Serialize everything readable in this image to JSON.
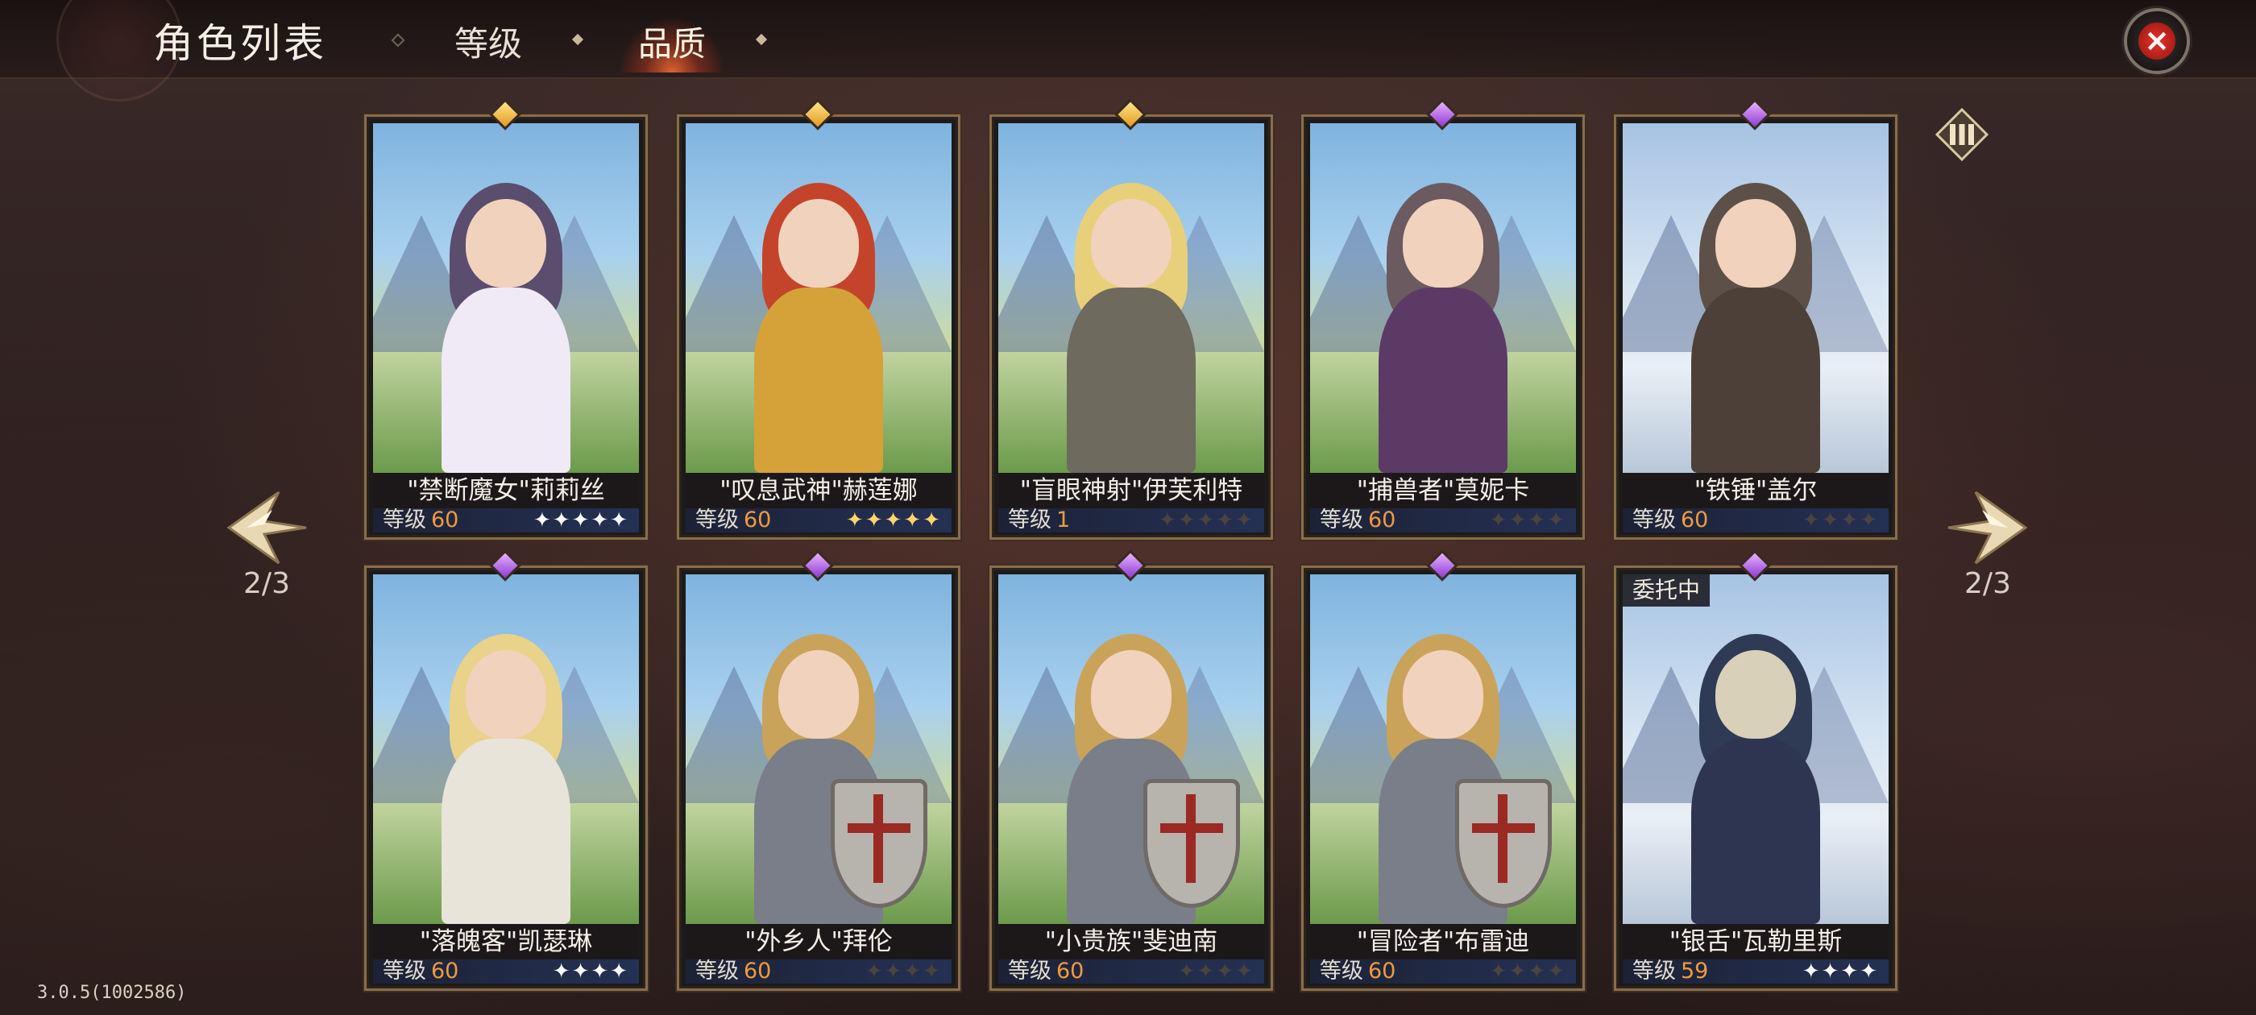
{
  "header": {
    "title": "角色列表",
    "tabs": [
      {
        "label": "等级",
        "active": false
      },
      {
        "label": "品质",
        "active": true
      }
    ]
  },
  "pagination": {
    "left": "2/3",
    "right": "2/3"
  },
  "version": "3.0.5(1002586)",
  "colors": {
    "level_number": "#f29a3a",
    "accent_active": "#e8572c",
    "gem_gold": "#e39b1e",
    "gem_purple": "#8d3ad3"
  },
  "level_label": "等级",
  "characters": [
    {
      "name": "\"禁断魔女\"莉莉丝",
      "level": "60",
      "gem": "gold",
      "stars": 5,
      "star_style": "white",
      "status": ""
    },
    {
      "name": "\"叹息武神\"赫莲娜",
      "level": "60",
      "gem": "gold",
      "stars": 5,
      "star_style": "gold",
      "status": ""
    },
    {
      "name": "\"盲眼神射\"伊芙利特",
      "level": "1",
      "gem": "gold",
      "stars": 5,
      "star_style": "dark",
      "status": ""
    },
    {
      "name": "\"捕兽者\"莫妮卡",
      "level": "60",
      "gem": "purple",
      "stars": 4,
      "star_style": "dark",
      "status": ""
    },
    {
      "name": "\"铁锤\"盖尔",
      "level": "60",
      "gem": "purple",
      "stars": 4,
      "star_style": "dark",
      "status": ""
    },
    {
      "name": "\"落魄客\"凯瑟琳",
      "level": "60",
      "gem": "purple",
      "stars": 4,
      "star_style": "white",
      "status": ""
    },
    {
      "name": "\"外乡人\"拜伦",
      "level": "60",
      "gem": "purple",
      "stars": 4,
      "star_style": "dark",
      "status": ""
    },
    {
      "name": "\"小贵族\"斐迪南",
      "level": "60",
      "gem": "purple",
      "stars": 4,
      "star_style": "dark",
      "status": ""
    },
    {
      "name": "\"冒险者\"布雷迪",
      "level": "60",
      "gem": "purple",
      "stars": 4,
      "star_style": "dark",
      "status": ""
    },
    {
      "name": "\"银舌\"瓦勒里斯",
      "level": "59",
      "gem": "purple",
      "stars": 4,
      "star_style": "white",
      "status": "委托中"
    }
  ]
}
